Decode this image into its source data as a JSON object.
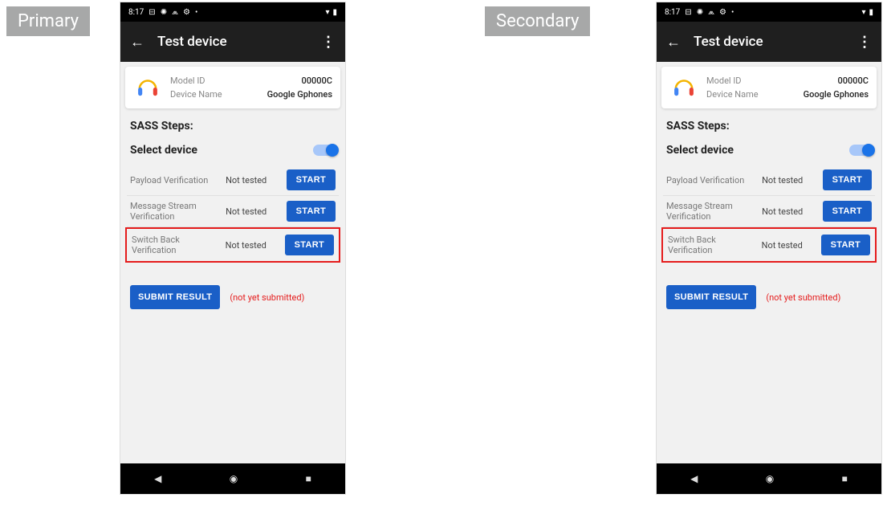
{
  "labels": {
    "primary": "Primary",
    "secondary": "Secondary"
  },
  "status": {
    "time": "8:17"
  },
  "appbar": {
    "title": "Test device"
  },
  "card": {
    "model_key": "Model ID",
    "model_val": "00000C",
    "name_key": "Device Name",
    "name_val": "Google Gphones"
  },
  "section": {
    "steps_title": "SASS Steps:",
    "select_label": "Select device"
  },
  "tests": {
    "payload": {
      "name": "Payload Verification",
      "status": "Not tested",
      "btn": "START"
    },
    "msgstream": {
      "name": "Message Stream Verification",
      "status": "Not tested",
      "btn": "START"
    },
    "switchback": {
      "name": "Switch Back Verification",
      "status": "Not tested",
      "btn": "START"
    }
  },
  "submit": {
    "btn": "SUBMIT RESULT",
    "status": "(not yet submitted)"
  }
}
